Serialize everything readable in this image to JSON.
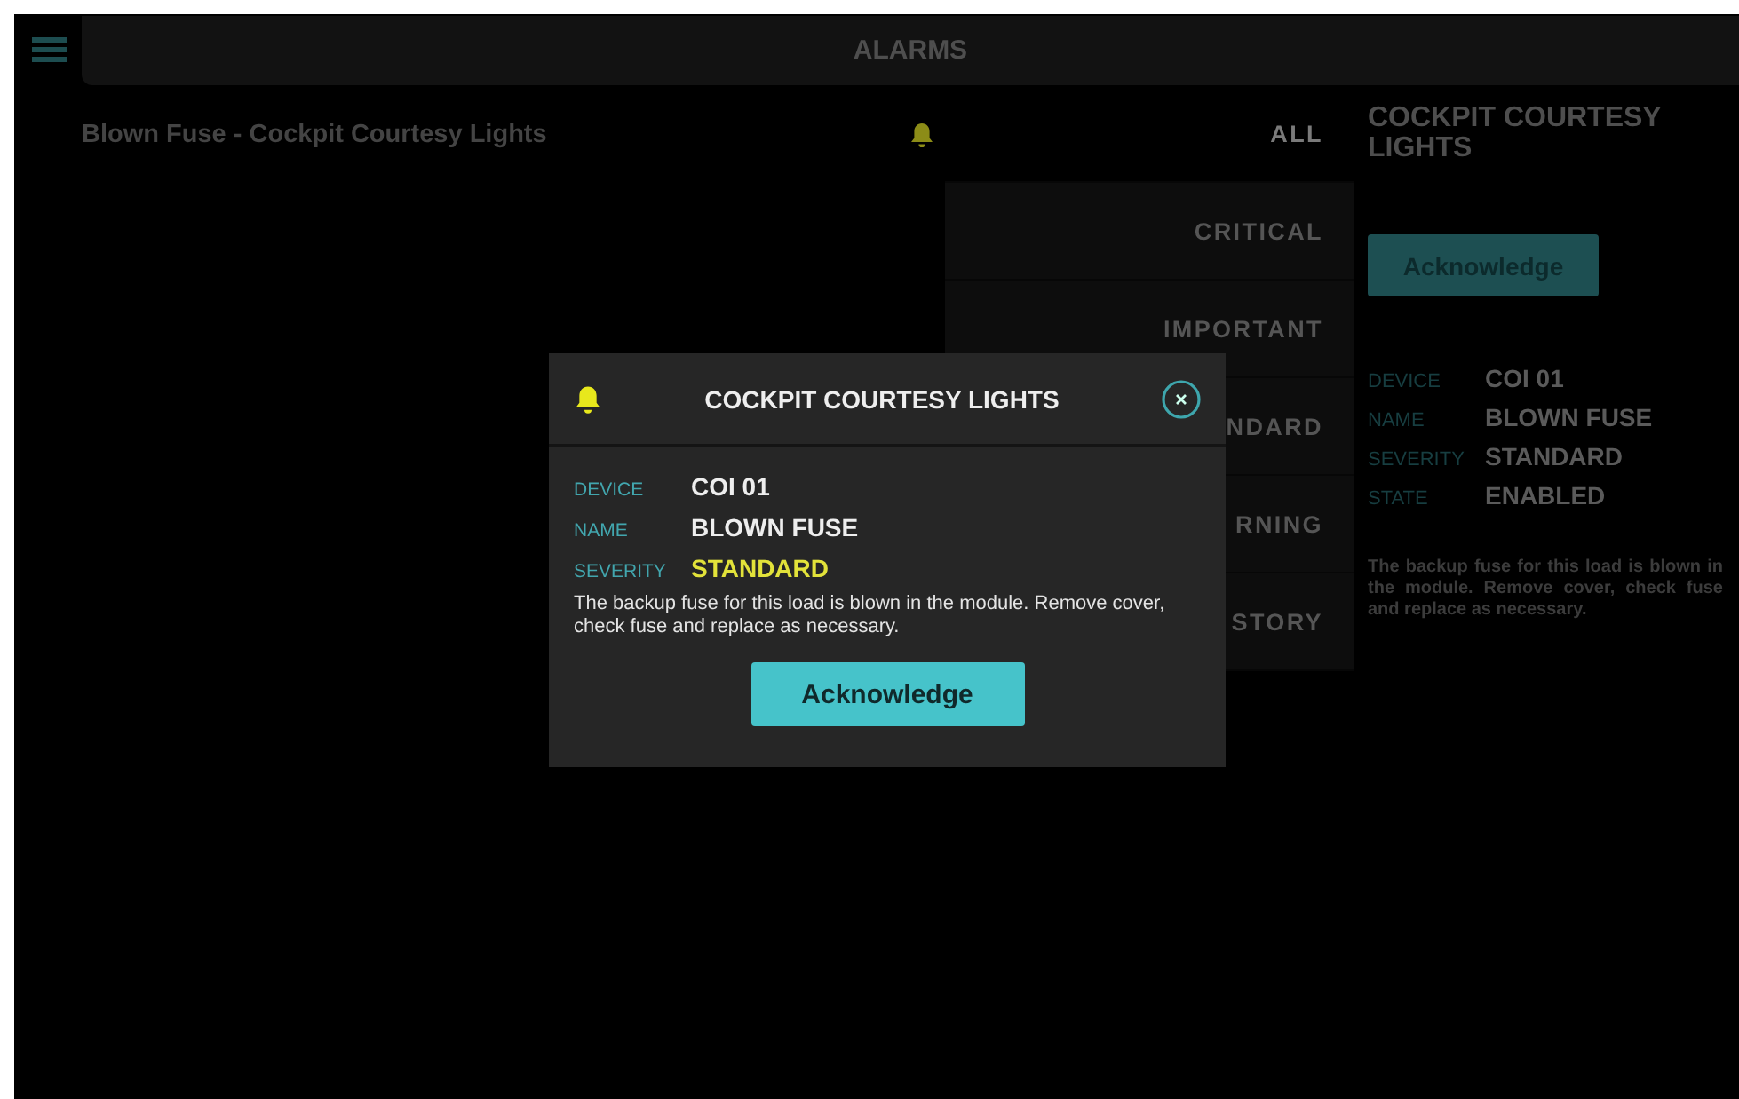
{
  "header": {
    "title": "ALARMS"
  },
  "alarms": [
    {
      "text": "Blown Fuse - Cockpit Courtesy Lights"
    }
  ],
  "filters": [
    {
      "label": "ALL",
      "selected": true
    },
    {
      "label": "CRITICAL",
      "selected": false
    },
    {
      "label": "IMPORTANT",
      "selected": false
    },
    {
      "label": "NDARD",
      "selected": false
    },
    {
      "label": "RNING",
      "selected": false
    },
    {
      "label": "STORY",
      "selected": false
    }
  ],
  "detail": {
    "title": "COCKPIT COURTESY LIGHTS",
    "button": "Acknowledge",
    "fields": [
      {
        "label": "DEVICE",
        "value": "COI 01"
      },
      {
        "label": "NAME",
        "value": "BLOWN FUSE"
      },
      {
        "label": "SEVERITY",
        "value": "STANDARD"
      },
      {
        "label": "STATE",
        "value": "ENABLED"
      }
    ],
    "description": "The backup fuse for this load is blown in the module. Remove cover, check fuse and replace as necessary."
  },
  "dialog": {
    "title": "COCKPIT COURTESY LIGHTS",
    "fields": [
      {
        "label": "DEVICE",
        "value": "COI 01",
        "highlighted": false
      },
      {
        "label": "NAME",
        "value": "BLOWN FUSE",
        "highlighted": false
      },
      {
        "label": "SEVERITY",
        "value": "STANDARD",
        "highlighted": true
      }
    ],
    "description": "The backup fuse for this load is blown in the module. Remove cover, check fuse and replace as necessary.",
    "button": "Acknowledge"
  }
}
